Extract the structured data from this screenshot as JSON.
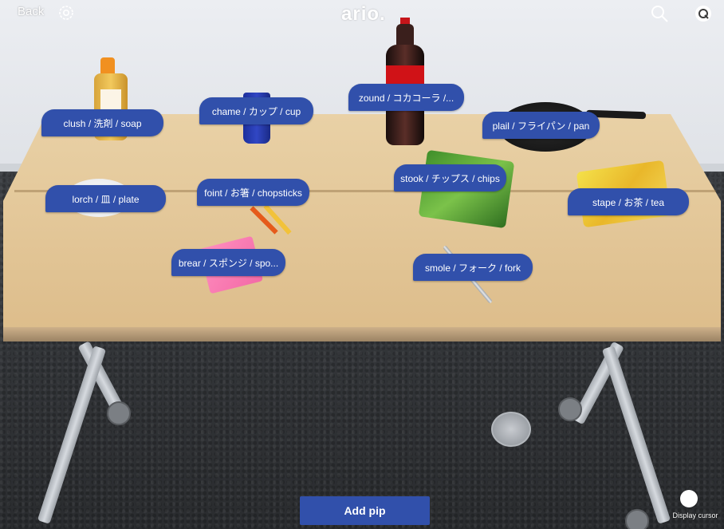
{
  "topbar": {
    "back_label": "Back",
    "logo_text": "ario.",
    "icons": [
      "gear-icon",
      "search-icon",
      "chat-icon"
    ]
  },
  "labels": [
    {
      "id": "soap",
      "text": "clush / 洗剤 / soap"
    },
    {
      "id": "cup",
      "text": "chame / カップ / cup"
    },
    {
      "id": "cola",
      "text": "zound / コカコーラ /..."
    },
    {
      "id": "pan",
      "text": "plail / フライパン / pan"
    },
    {
      "id": "plate",
      "text": "lorch / 皿 / plate"
    },
    {
      "id": "chopsticks",
      "text": "foint / お箸 / chopsticks"
    },
    {
      "id": "chips",
      "text": "stook / チップス / chips"
    },
    {
      "id": "tea",
      "text": "stape / お茶 / tea"
    },
    {
      "id": "sponge",
      "text": "brear / スポンジ / spo..."
    },
    {
      "id": "fork",
      "text": "smole / フォーク / fork"
    }
  ],
  "bottom": {
    "add_pip_label": "Add pip",
    "display_cursor_label": "Display cursor"
  },
  "colors": {
    "accent": "#3150ab",
    "label_text": "#ffffff"
  }
}
